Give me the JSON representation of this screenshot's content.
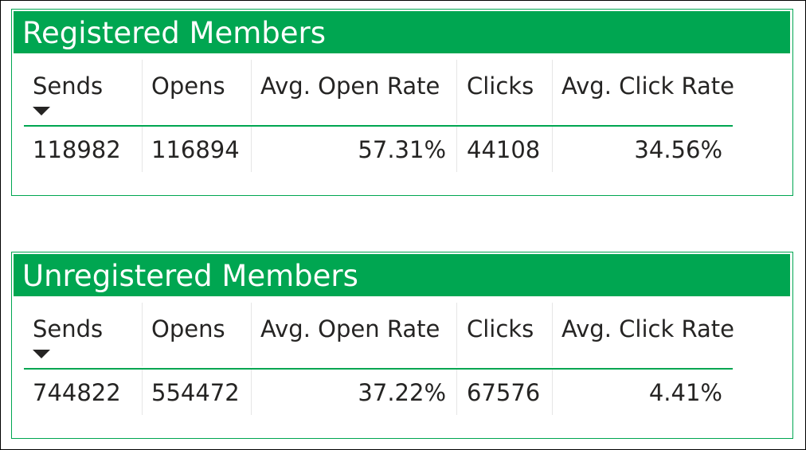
{
  "panels": [
    {
      "title": "Registered Members",
      "columns": [
        "Sends",
        "Opens",
        "Avg. Open Rate",
        "Clicks",
        "Avg. Click Rate"
      ],
      "sort_column": "Sends",
      "sort_direction": "descending",
      "rows": [
        [
          "118982",
          "116894",
          "57.31%",
          "44108",
          "34.56%"
        ]
      ]
    },
    {
      "title": "Unregistered Members",
      "columns": [
        "Sends",
        "Opens",
        "Avg. Open Rate",
        "Clicks",
        "Avg. Click Rate"
      ],
      "sort_column": "Sends",
      "sort_direction": "descending",
      "rows": [
        [
          "744822",
          "554472",
          "37.22%",
          "67576",
          "4.41%"
        ]
      ]
    }
  ],
  "colors": {
    "accent": "#00A651",
    "text": "#252423",
    "header_text": "#ffffff",
    "divider": "#e6e6e6"
  },
  "icons": {
    "sort": "triangle-down-icon"
  }
}
